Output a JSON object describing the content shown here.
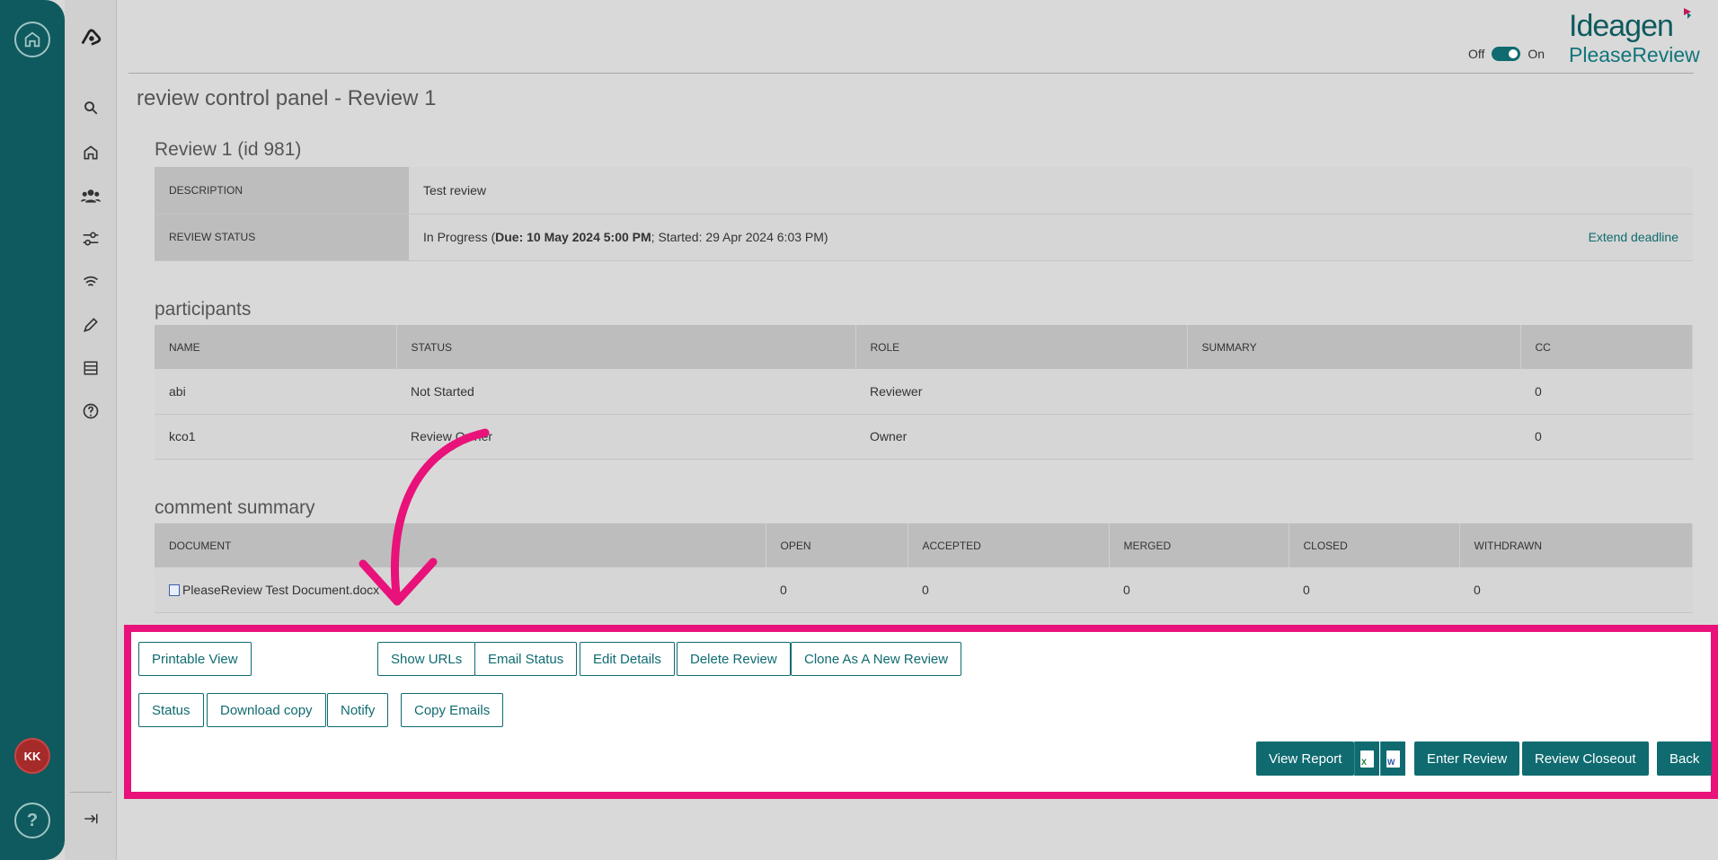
{
  "rail": {
    "avatar_initials": "KK",
    "help_label": "?"
  },
  "header": {
    "toggle_off": "Off",
    "toggle_on": "On",
    "brand_top": "Ideagen",
    "brand_bottom": "PleaseReview"
  },
  "page_title": "review control panel - Review 1",
  "review": {
    "heading": "Review 1  (id 981)",
    "description_label": "DESCRIPTION",
    "description_value": "Test review",
    "status_label": "REVIEW STATUS",
    "status_prefix": "In Progress (",
    "status_due": "Due: 10 May 2024 5:00 PM",
    "status_suffix": "; Started: 29 Apr 2024 6:03 PM)",
    "extend_link": "Extend deadline"
  },
  "participants": {
    "heading": "participants",
    "columns": [
      "NAME",
      "STATUS",
      "ROLE",
      "SUMMARY",
      "CC"
    ],
    "rows": [
      [
        "abi",
        "Not Started",
        "Reviewer",
        "",
        "0"
      ],
      [
        "kco1",
        "Review Owner",
        "Owner",
        "",
        "0"
      ]
    ]
  },
  "comment_summary": {
    "heading": "comment summary",
    "columns": [
      "DOCUMENT",
      "OPEN",
      "ACCEPTED",
      "MERGED",
      "CLOSED",
      "WITHDRAWN"
    ],
    "rows": [
      [
        "PleaseReview Test Document.docx",
        "0",
        "0",
        "0",
        "0",
        "0"
      ]
    ]
  },
  "actions": {
    "printable_view": "Printable View",
    "show_urls": "Show URLs",
    "email_status": "Email Status",
    "edit_details": "Edit Details",
    "delete_review": "Delete Review",
    "clone": "Clone As A New Review",
    "status": "Status",
    "download_copy": "Download copy",
    "notify": "Notify",
    "copy_emails": "Copy Emails",
    "view_report": "View Report",
    "excel_glyph": "X",
    "word_glyph": "W",
    "enter_review": "Enter Review",
    "review_closeout": "Review Closeout",
    "back": "Back"
  },
  "colors": {
    "accent": "#0f6b70",
    "highlight": "#e8127a",
    "rail": "#0f5a5e"
  }
}
